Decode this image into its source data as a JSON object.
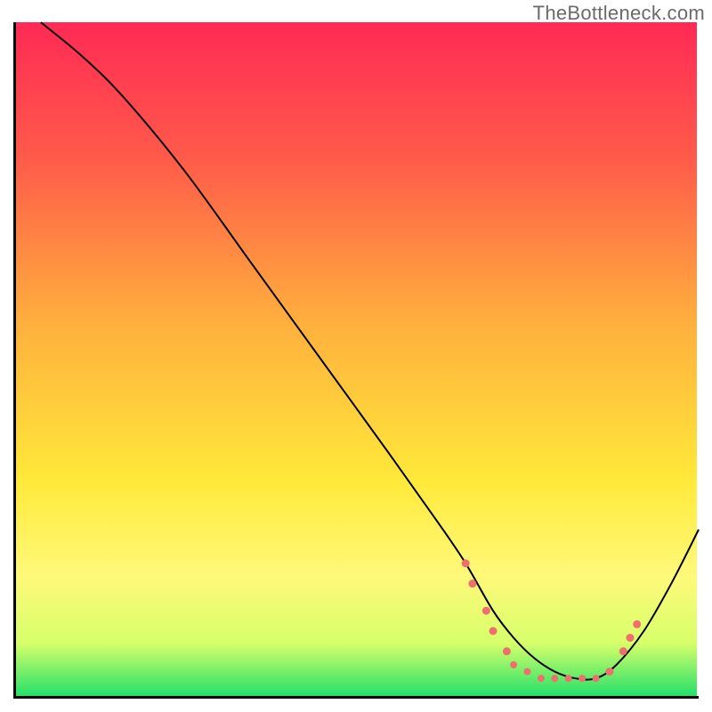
{
  "watermark": "TheBottleneck.com",
  "chart_data": {
    "type": "line",
    "title": "",
    "xlabel": "",
    "ylabel": "",
    "xlim": [
      0,
      100
    ],
    "ylim": [
      0,
      100
    ],
    "background_gradient": {
      "stops": [
        {
          "offset": 0.0,
          "color": "#ff2a55"
        },
        {
          "offset": 0.2,
          "color": "#ff5a4a"
        },
        {
          "offset": 0.45,
          "color": "#ffb13d"
        },
        {
          "offset": 0.68,
          "color": "#ffe93a"
        },
        {
          "offset": 0.82,
          "color": "#fff97a"
        },
        {
          "offset": 0.92,
          "color": "#d7ff6a"
        },
        {
          "offset": 1.0,
          "color": "#22e06a"
        }
      ]
    },
    "series": [
      {
        "name": "bottleneck-curve",
        "x": [
          4,
          10,
          16,
          25,
          35,
          45,
          55,
          62,
          66,
          70,
          73,
          76,
          79,
          82,
          85,
          88,
          92,
          96,
          100
        ],
        "y": [
          100,
          95,
          89,
          78,
          64,
          50,
          36,
          26,
          20,
          13,
          9,
          6,
          4,
          3,
          3,
          5,
          10,
          17,
          25
        ]
      }
    ],
    "markers": {
      "name": "valley-markers",
      "color": "#ef6f6f",
      "points": [
        {
          "x": 66,
          "y": 20,
          "r": 4.5
        },
        {
          "x": 67,
          "y": 17,
          "r": 4.5
        },
        {
          "x": 69,
          "y": 13,
          "r": 4.5
        },
        {
          "x": 70,
          "y": 10,
          "r": 4.5
        },
        {
          "x": 72,
          "y": 7,
          "r": 4.5
        },
        {
          "x": 73,
          "y": 5,
          "r": 4.0
        },
        {
          "x": 75,
          "y": 4,
          "r": 4.0
        },
        {
          "x": 77,
          "y": 3,
          "r": 4.0
        },
        {
          "x": 79,
          "y": 3,
          "r": 4.0
        },
        {
          "x": 81,
          "y": 3,
          "r": 4.0
        },
        {
          "x": 83,
          "y": 3,
          "r": 4.0
        },
        {
          "x": 85,
          "y": 3,
          "r": 4.0
        },
        {
          "x": 87,
          "y": 4,
          "r": 4.5
        },
        {
          "x": 89,
          "y": 7,
          "r": 4.5
        },
        {
          "x": 90,
          "y": 9,
          "r": 4.5
        },
        {
          "x": 91,
          "y": 11,
          "r": 4.5
        }
      ]
    }
  }
}
